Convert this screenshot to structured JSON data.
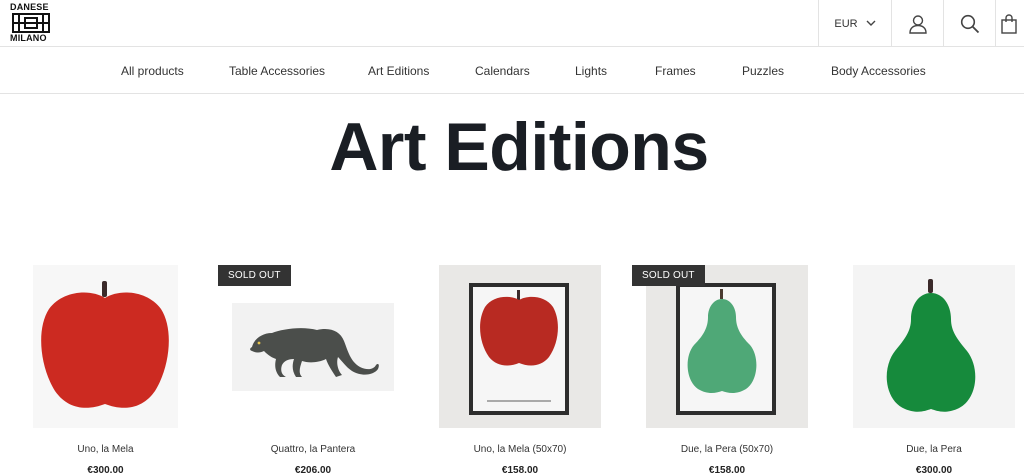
{
  "brand": {
    "logo_top": "DANESE",
    "logo_bottom": "MILANO"
  },
  "header": {
    "currency": "EUR"
  },
  "icons": {
    "account": "user-icon",
    "search": "search-icon",
    "cart": "bag-icon",
    "currency": "chevron-down-icon"
  },
  "nav": {
    "items": [
      "All products",
      "Table Accessories",
      "Art Editions",
      "Calendars",
      "Lights",
      "Frames",
      "Puzzles",
      "Body Accessories"
    ]
  },
  "page": {
    "title": "Art Editions"
  },
  "products": [
    {
      "name": "Uno, la Mela",
      "price": "€300.00",
      "badge": ""
    },
    {
      "name": "Quattro, la Pantera",
      "price": "€206.00",
      "badge": "SOLD OUT"
    },
    {
      "name": "Uno, la Mela (50x70)",
      "price": "€158.00",
      "badge": ""
    },
    {
      "name": "Due, la Pera (50x70)",
      "price": "€158.00",
      "badge": "SOLD OUT"
    },
    {
      "name": "Due, la Pera",
      "price": "€300.00",
      "badge": ""
    }
  ],
  "colors": {
    "apple_red": "#cc2a21",
    "pear_green": "#168a3c",
    "pear_light": "#4fa877",
    "panther": "#4b4e4b",
    "title": "#1a1e24"
  }
}
